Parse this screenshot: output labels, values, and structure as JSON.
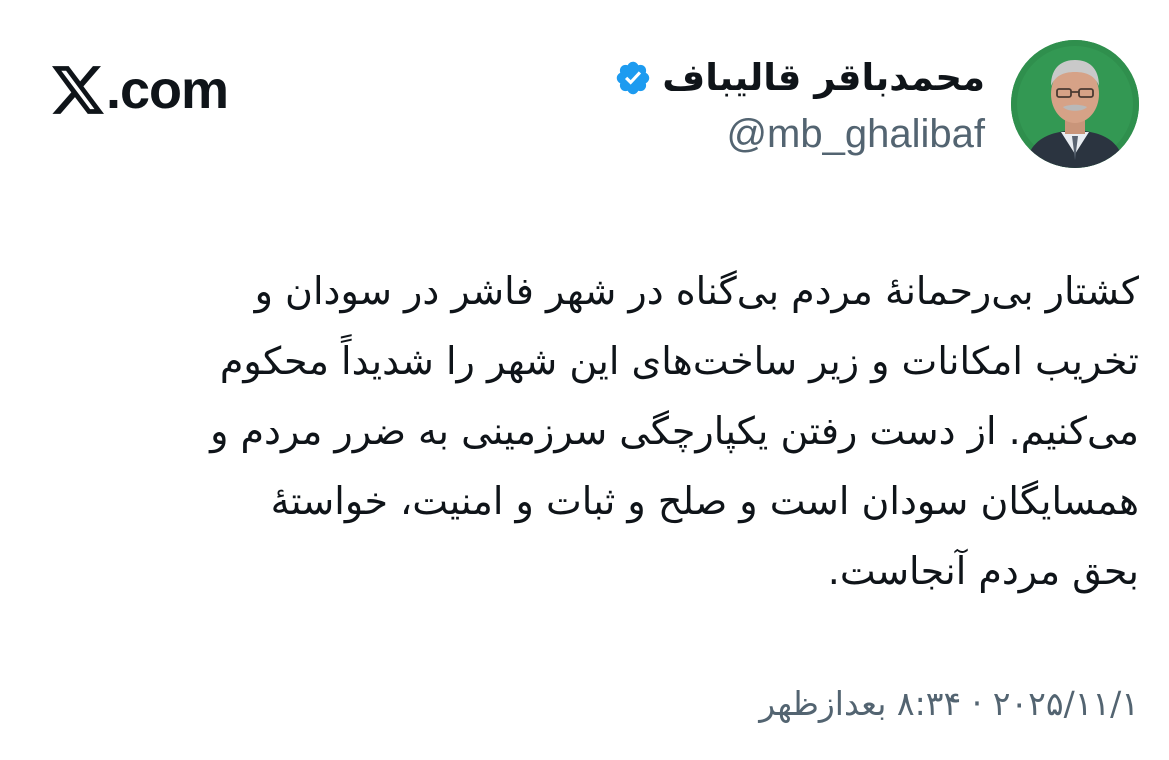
{
  "brand": {
    "logo_icon": "x-logo-icon",
    "domain": ".com"
  },
  "author": {
    "display_name": "محمدباقر قالیباف",
    "handle": "@mb_ghalibaf",
    "verified_icon": "verified-badge-icon",
    "verified_color": "#1d9bf0",
    "avatar_icon": "profile-photo"
  },
  "tweet": {
    "lines": [
      "کشتار بی‌رحمانهٔ مردم بی‌گناه در شهر فاشر در سودان و",
      "تخریب امکانات و زیر ساخت‌های این شهر را شدیداً محکوم",
      "می‌کنیم. از دست رفتن یکپارچگی سرزمینی به ضرر مردم و",
      "همسایگان سودان است و صلح و ثبات و امنیت، خواستهٔ",
      "بحق مردم آنجاست."
    ],
    "timestamp": "۲۰۲۵/۱۱/۱ · ۸:۳۴ بعدازظهر"
  },
  "colors": {
    "text_primary": "#0f1419",
    "text_secondary": "#536471",
    "background": "#ffffff"
  }
}
